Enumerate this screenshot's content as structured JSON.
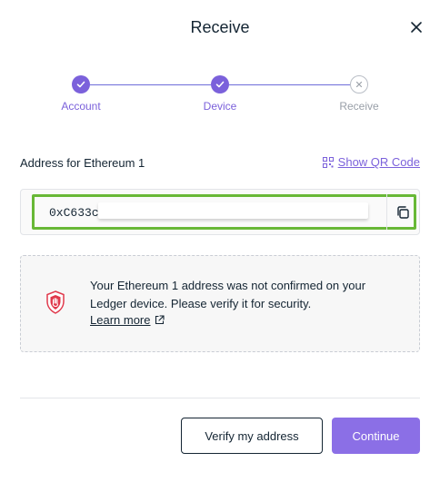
{
  "modal": {
    "title": "Receive"
  },
  "stepper": {
    "steps": [
      {
        "label": "Account",
        "status": "done"
      },
      {
        "label": "Device",
        "status": "done"
      },
      {
        "label": "Receive",
        "status": "pending"
      }
    ]
  },
  "address": {
    "label": "Address for Ethereum 1",
    "show_qr_label": "Show QR Code",
    "value_prefix": "0xC633c"
  },
  "warning": {
    "message": "Your Ethereum 1 address was not confirmed on your Ledger device. Please verify it for security.",
    "learn_more_label": "Learn more"
  },
  "footer": {
    "verify_label": "Verify my address",
    "continue_label": "Continue"
  },
  "colors": {
    "accent": "#7b61db",
    "highlight": "#68b836",
    "warning_red": "#e0384b"
  },
  "icons": {
    "close": "close-icon",
    "qr": "qr-code-icon",
    "copy": "copy-icon",
    "warning": "shield-hand-icon",
    "external": "external-link-icon"
  }
}
